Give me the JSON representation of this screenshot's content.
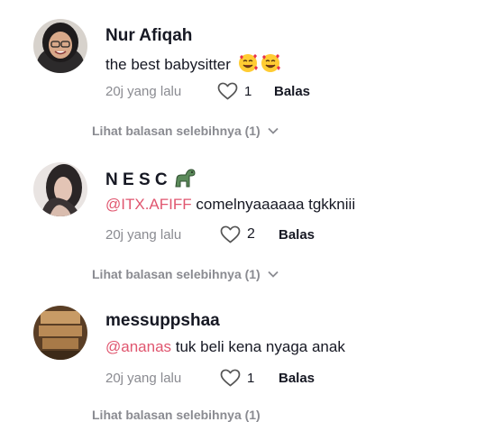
{
  "comments": [
    {
      "name": "Nur Afiqah",
      "mention": "",
      "text": "the best babysitter",
      "emojis": [
        "smiling-face-with-hearts",
        "smiling-face-with-hearts"
      ],
      "time": "20j yang lalu",
      "likes": "1",
      "reply": "Balas",
      "more": "Lihat balasan selebihnya (1)"
    },
    {
      "name": "N E S C",
      "name_emoji": "dinosaur",
      "mention": "@ITX.AFIFF",
      "text": " comelnyaaaaaa tgkkniii",
      "time": "20j yang lalu",
      "likes": "2",
      "reply": "Balas",
      "more": "Lihat balasan selebihnya (1)"
    },
    {
      "name": "messuppshaa",
      "mention": "@ananas",
      "text": " tuk beli kena nyaga anak",
      "time": "20j yang lalu",
      "likes": "1",
      "reply": "Balas",
      "more": "Lihat balasan selebihnya (1)"
    }
  ],
  "colors": {
    "mention": "#e0566f",
    "muted": "#8a8b91",
    "text": "#161823"
  }
}
